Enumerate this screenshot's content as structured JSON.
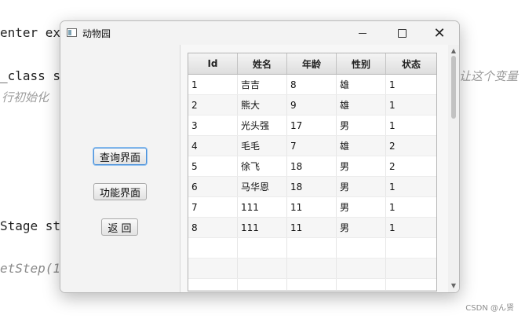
{
  "background": {
    "code_lines": [
      "enter ex",
      "_class s",
      "Stage st",
      "etStep(1"
    ],
    "comment_right": "让这个变量",
    "comment_left": "行初始化",
    "watermark": "CSDN @ん贤"
  },
  "window": {
    "title": "动物园",
    "minimize_label": "—",
    "close_label": "✕"
  },
  "buttons": {
    "query": "查询界面",
    "function": "功能界面",
    "back": "返 回"
  },
  "table": {
    "columns": [
      "Id",
      "姓名",
      "年龄",
      "性别",
      "状态"
    ],
    "rows": [
      [
        "1",
        "吉吉",
        "8",
        "雄",
        "1"
      ],
      [
        "2",
        "熊大",
        "9",
        "雄",
        "1"
      ],
      [
        "3",
        "光头强",
        "17",
        "男",
        "1"
      ],
      [
        "4",
        "毛毛",
        "7",
        "雄",
        "2"
      ],
      [
        "5",
        "徐飞",
        "18",
        "男",
        "2"
      ],
      [
        "6",
        "马华恩",
        "18",
        "男",
        "1"
      ],
      [
        "7",
        "111",
        "11",
        "男",
        "1"
      ],
      [
        "8",
        "111",
        "11",
        "男",
        "1"
      ]
    ]
  },
  "colors": {
    "focus_border": "#4a90d9",
    "keyword": "#2b2bb3"
  }
}
